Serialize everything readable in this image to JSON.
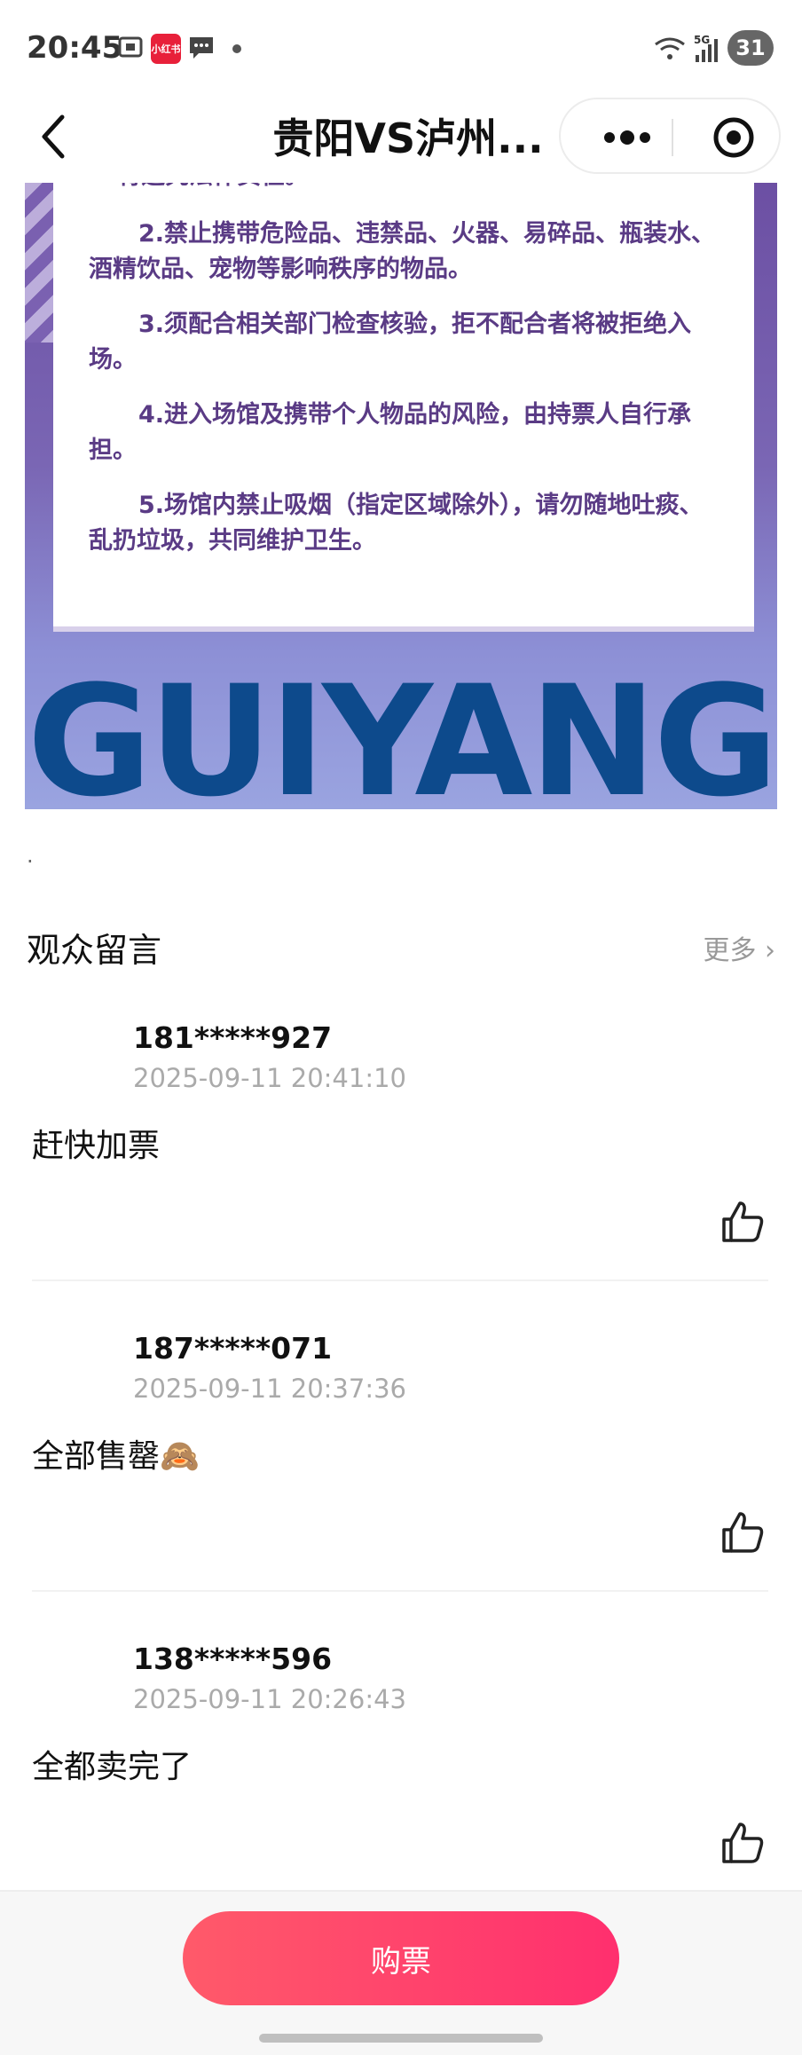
{
  "status_bar": {
    "time": "20:45",
    "app_badge": "小红书",
    "network": "5G",
    "battery": "31"
  },
  "nav": {
    "title": "贵阳VS泸州...",
    "back_icon": "chevron-left-icon",
    "more_icon": "more-dots-icon",
    "close_icon": "target-close-icon"
  },
  "poster": {
    "top_partial": "将追究法律责任。",
    "rules": [
      "2.禁止携带危险品、违禁品、火器、易碎品、瓶装水、酒精饮品、宠物等影响秩序的物品。",
      "3.须配合相关部门检查核验，拒不配合者将被拒绝入场。",
      "4.进入场馆及携带个人物品的风险，由持票人自行承担。",
      "5.场馆内禁止吸烟（指定区域除外），请勿随地吐痰、乱扔垃圾，共同维护卫生。"
    ],
    "big_word": "GUIYANG",
    "colors": {
      "bg_top": "#6c4fa3",
      "bg_bottom": "#9aa4e0",
      "word": "#0d4a8c",
      "rule_text": "#5a3b85"
    }
  },
  "dot": ".",
  "comments_section": {
    "title": "观众留言",
    "more_label": "更多 ›",
    "items": [
      {
        "user": "181*****927",
        "time": "2025-09-11 20:41:10",
        "text": "赶快加票"
      },
      {
        "user": "187*****071",
        "time": "2025-09-11 20:37:36",
        "text": "全部售罄🙈"
      },
      {
        "user": "138*****596",
        "time": "2025-09-11 20:26:43",
        "text": "全都卖完了"
      }
    ]
  },
  "footer": {
    "buy_label": "购票",
    "accent": "#ff3a6c"
  }
}
